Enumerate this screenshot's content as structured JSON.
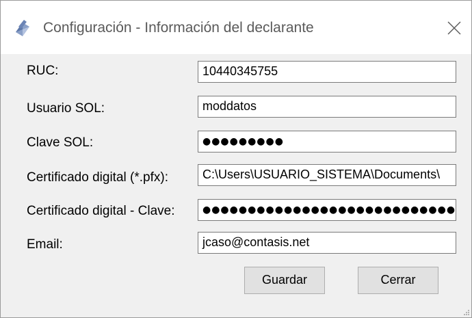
{
  "window": {
    "title": "Configuración - Información del declarante",
    "icon": "app-icon",
    "close_icon": "close-icon"
  },
  "form": {
    "ruc": {
      "label": "RUC:",
      "value": "10440345755"
    },
    "usuario_sol": {
      "label": "Usuario SOL:",
      "value": "moddatos"
    },
    "clave_sol": {
      "label": "Clave SOL:",
      "value": "●●●●●●●●●"
    },
    "certificado": {
      "label": "Certificado digital (*.pfx):",
      "value": "C:\\Users\\USUARIO_SISTEMA\\Documents\\"
    },
    "certificado_clave": {
      "label": "Certificado digital - Clave:",
      "value": "●●●●●●●●●●●●●●●●●●●●●●●●●●●●●●●●●●"
    },
    "email": {
      "label": "Email:",
      "value": "jcaso@contasis.net"
    }
  },
  "buttons": {
    "save": "Guardar",
    "close": "Cerrar"
  }
}
